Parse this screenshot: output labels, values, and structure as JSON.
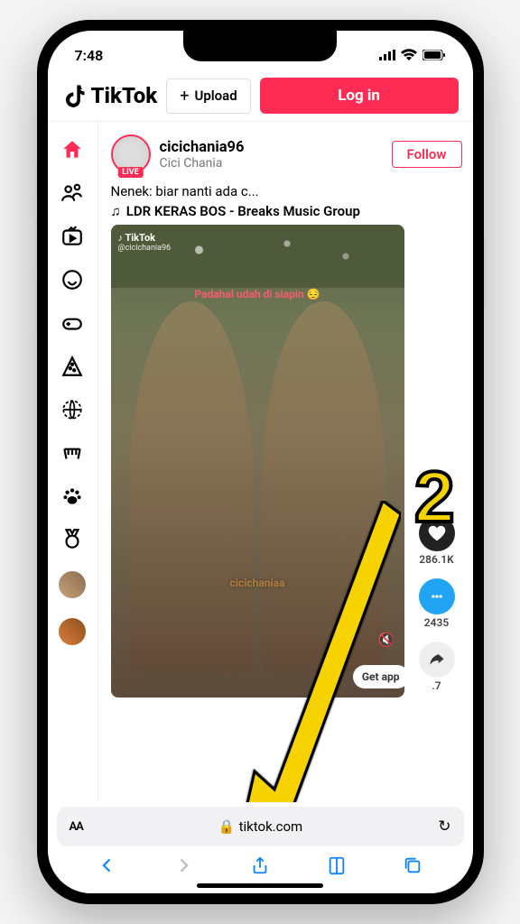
{
  "status": {
    "time": "7:48"
  },
  "header": {
    "brand": "TikTok",
    "upload_label": "Upload",
    "login_label": "Log in"
  },
  "post": {
    "live_badge": "LIVE",
    "username": "cicichania96",
    "displayname": "Cici Chania",
    "follow_label": "Follow",
    "caption": "Nenek: biar nanti ada c...",
    "music": "LDR KERAS BOS - Breaks Music Group",
    "watermark_brand": "TikTok",
    "watermark_user": "@cicichania96",
    "overlay_text": "Padahal udah di siapin",
    "overlay_user": "cicichaniaa",
    "getapp_label": "Get app"
  },
  "actions": {
    "likes": "286.1K",
    "comments": "2435",
    "shares": ".7"
  },
  "safari": {
    "aa": "AA",
    "url": "tiktok.com"
  },
  "annotation": {
    "step": "2"
  }
}
